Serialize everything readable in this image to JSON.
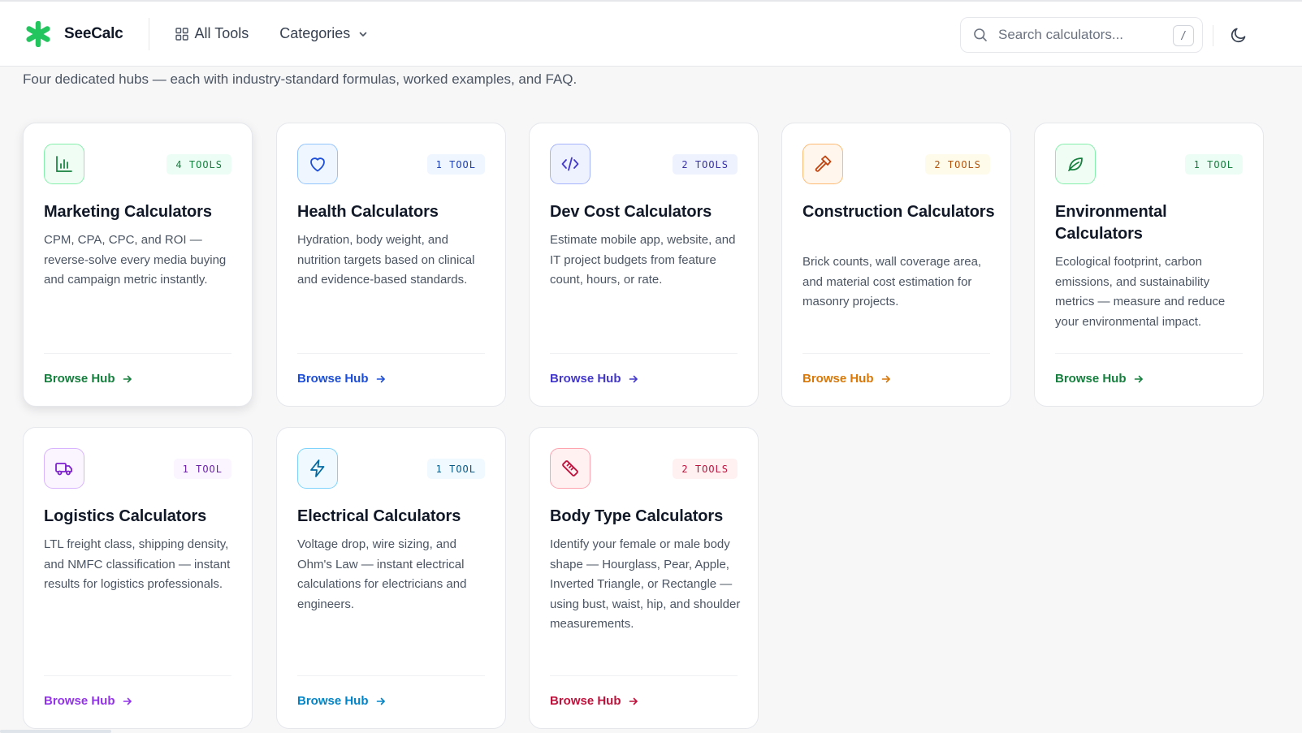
{
  "header": {
    "brand": "SeeCalc",
    "nav_all": "All Tools",
    "nav_categories": "Categories",
    "search_placeholder": "Search calculators...",
    "search_shortcut": "/"
  },
  "intro": {
    "subtitle": "Four dedicated hubs — each with industry-standard formulas, worked examples, and FAQ."
  },
  "colors": {
    "brand_green": "#22c55e",
    "marketing": "#15803d",
    "health": "#1d4ed8",
    "dev": "#4338ca",
    "construction": "#c2410c",
    "environmental": "#15803d",
    "logistics": "#7e22ce",
    "electrical": "#0369a1",
    "body": "#be123c"
  },
  "hubs": [
    {
      "icon": "bar-chart-icon",
      "badge": "4 TOOLS",
      "title": "Marketing Calculators",
      "description": "CPM, CPA, CPC, and ROI — reverse-solve every media buying and campaign metric instantly.",
      "link": "Browse Hub"
    },
    {
      "icon": "heart-icon",
      "badge": "1 TOOL",
      "title": "Health Calculators",
      "description": "Hydration, body weight, and nutrition targets based on clinical and evidence-based standards.",
      "link": "Browse Hub"
    },
    {
      "icon": "code-icon",
      "badge": "2 TOOLS",
      "title": "Dev Cost Calculators",
      "description": "Estimate mobile app, website, and IT project budgets from feature count, hours, or rate.",
      "link": "Browse Hub"
    },
    {
      "icon": "hammer-icon",
      "badge": "2 TOOLS",
      "title": "Construction Calculators",
      "description": "Brick counts, wall coverage area, and material cost estimation for masonry projects.",
      "link": "Browse Hub"
    },
    {
      "icon": "leaf-icon",
      "badge": "1 TOOL",
      "title": "Environmental Calculators",
      "description": "Ecological footprint, carbon emissions, and sustainability metrics — measure and reduce your environmental impact.",
      "link": "Browse Hub"
    },
    {
      "icon": "truck-icon",
      "badge": "1 TOOL",
      "title": "Logistics Calculators",
      "description": "LTL freight class, shipping density, and NMFC classification — instant results for logistics professionals.",
      "link": "Browse Hub"
    },
    {
      "icon": "lightning-icon",
      "badge": "1 TOOL",
      "title": "Electrical Calculators",
      "description": "Voltage drop, wire sizing, and Ohm's Law — instant electrical calculations for electricians and engineers.",
      "link": "Browse Hub"
    },
    {
      "icon": "ruler-icon",
      "badge": "2 TOOLS",
      "title": "Body Type Calculators",
      "description": "Identify your female or male body shape — Hourglass, Pear, Apple, Inverted Triangle, or Rectangle — using bust, waist, hip, and shoulder measurements.",
      "link": "Browse Hub"
    }
  ]
}
